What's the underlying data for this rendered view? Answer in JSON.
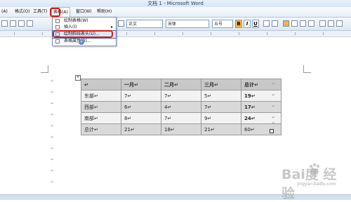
{
  "window": {
    "title": "文档 1 - Microsoft Word"
  },
  "menubar": {
    "items": [
      "(A)",
      "格式(O)",
      "工具(T)",
      "表格(A)",
      "窗口(W)",
      "帮助(H)"
    ]
  },
  "toolbar": {
    "style": "正文",
    "font": "宋体",
    "size": "五号",
    "bold": "B",
    "italic": "I",
    "underline": "U"
  },
  "table_menu": {
    "items": [
      {
        "label": "绘制表格(W)",
        "icon": "pencil-icon"
      },
      {
        "label": "插入(I)",
        "icon": "insert-icon",
        "submenu": true
      },
      {
        "label": "绘制斜线表头(U)...",
        "icon": "diagonal-header-icon"
      },
      {
        "label": "表格属性(R)...",
        "icon": "table-properties-icon"
      }
    ]
  },
  "table": {
    "header": [
      "↵",
      "一月↵",
      "二月↵",
      "三月↵",
      "总计↵"
    ],
    "rows": [
      [
        "东部↵",
        "7↵",
        "7↵",
        "5↵",
        "19↵"
      ],
      [
        "西部↵",
        "6↵",
        "4↵",
        "7↵",
        "17↵"
      ],
      [
        "南部↵",
        "8↵",
        "7↵",
        "9↵",
        "24↵"
      ],
      [
        "总计↵",
        "21↵",
        "18↵",
        "21↵",
        "60↵"
      ]
    ]
  },
  "watermark": {
    "text": "Bai度 经验",
    "sub": "jingyan.baidu.com"
  },
  "colors": {
    "highlight_box": "#e01818",
    "menu_highlight": "#dbe8fb",
    "bold_active": "#f3b43c"
  }
}
